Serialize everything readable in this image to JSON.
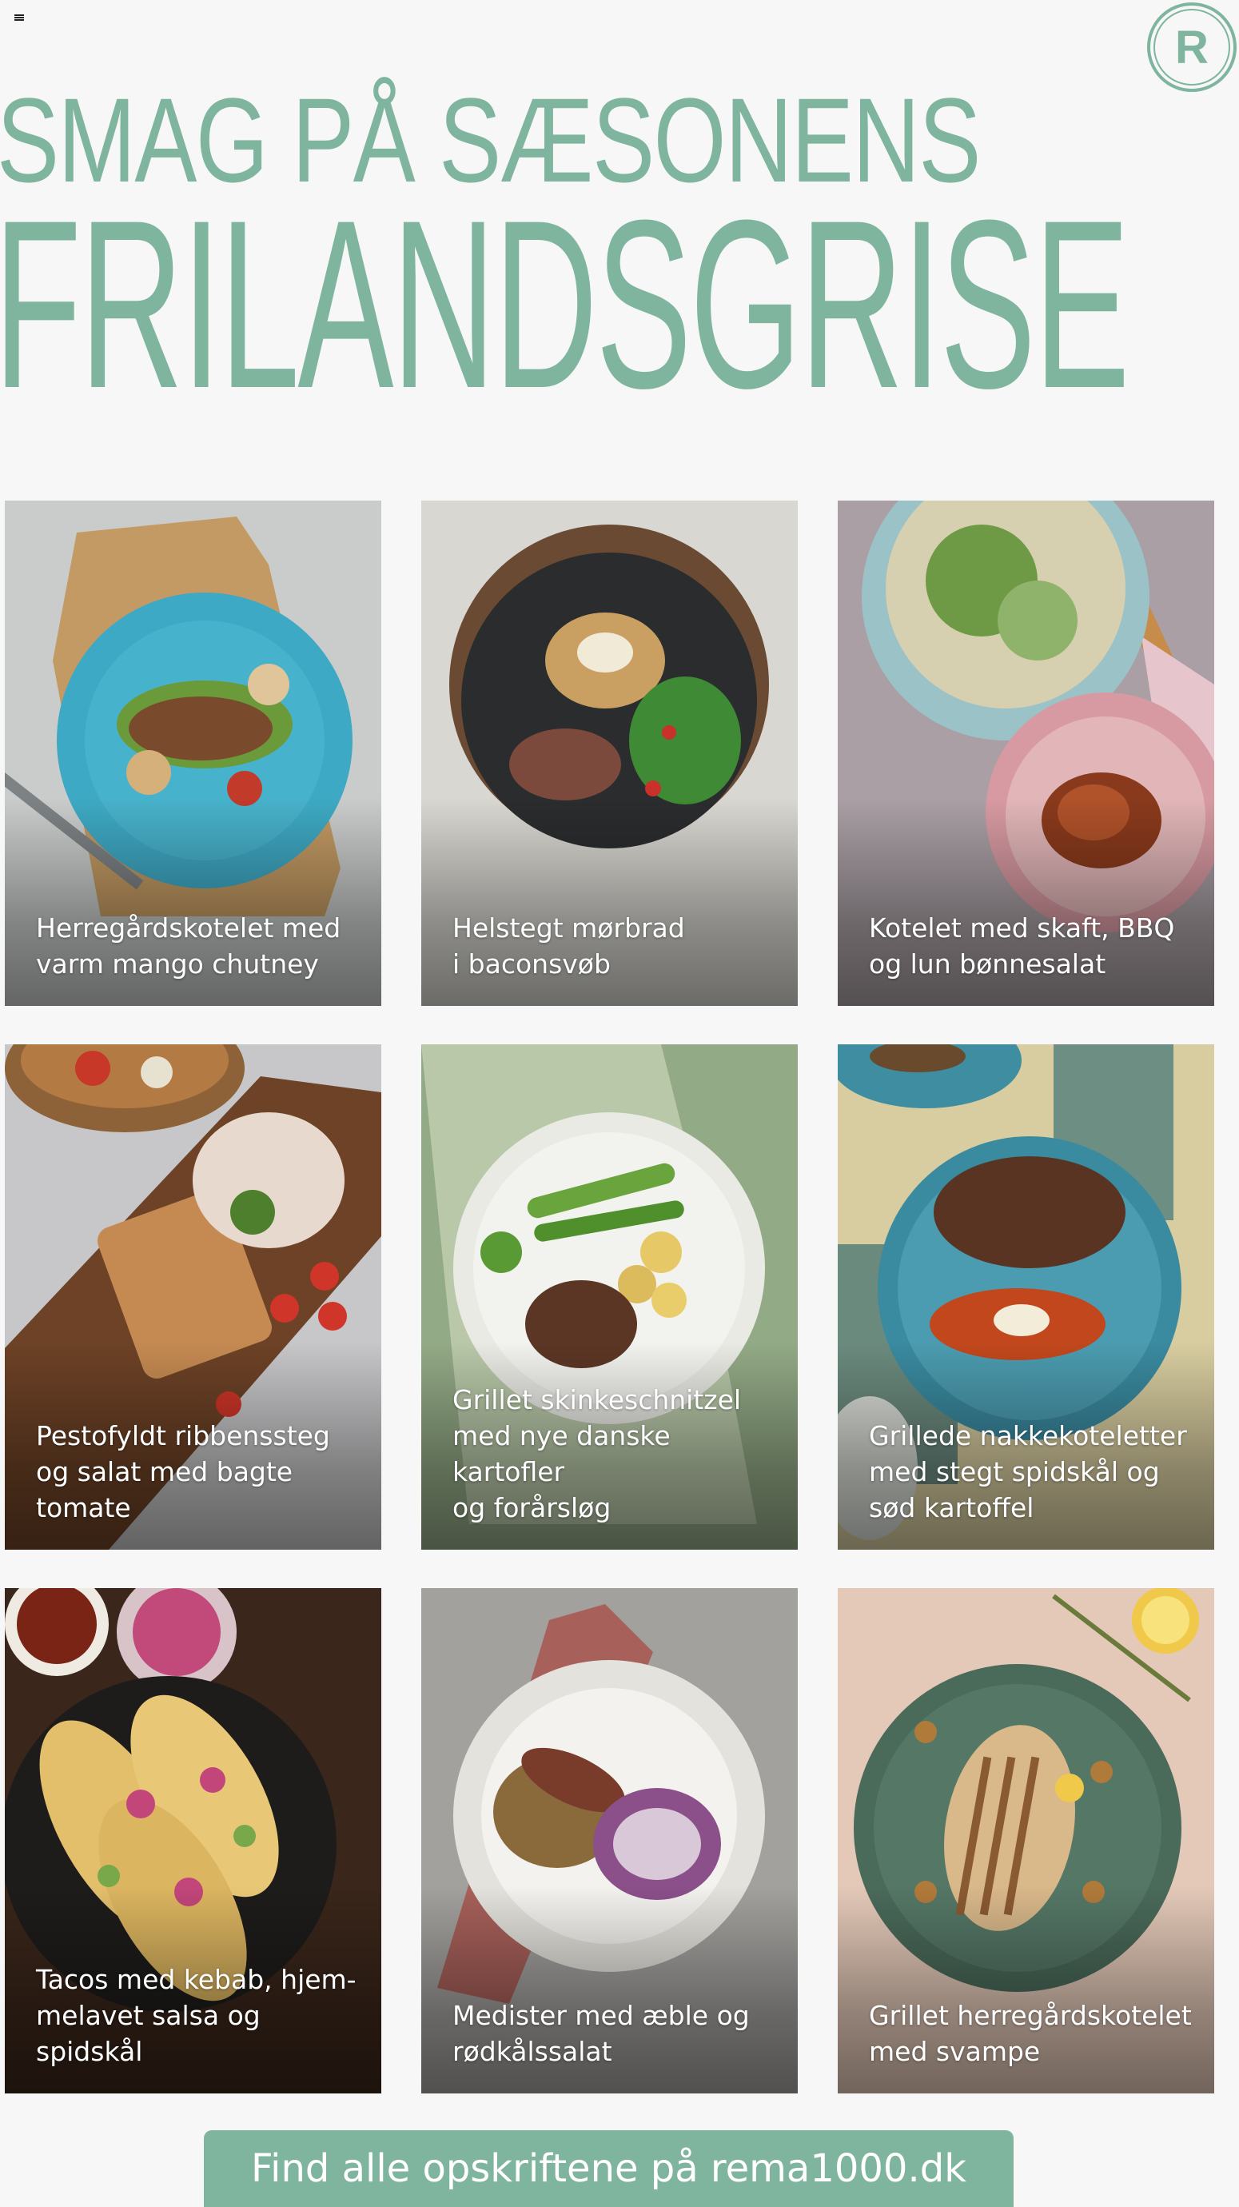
{
  "header": {
    "menu_icon": "menu-icon",
    "logo_letter": "R",
    "title_line1": "SMAG PÅ SÆSONENS",
    "title_line2": "FRILANDSGRISE"
  },
  "colors": {
    "brand_green": "#7fb59e",
    "background": "#f6f7f6",
    "caption_text": "#ffffff"
  },
  "recipes": [
    {
      "caption": "Herregårdskotelet med\nvarm mango chutney"
    },
    {
      "caption": "Helstegt mørbrad\ni baconsvøb"
    },
    {
      "caption": "Kotelet med skaft, BBQ\nog lun bønnesalat"
    },
    {
      "caption": "Pestofyldt ribbenssteg\nog salat med bagte\ntomate"
    },
    {
      "caption": "Grillet skinkeschnitzel\nmed nye danske kartofler\nog forårsløg"
    },
    {
      "caption": "Grillede nakkekoteletter\nmed stegt spidskål og\nsød kartoffel"
    },
    {
      "caption": "Tacos med kebab, hjem-\nmelavet salsa og spidskål"
    },
    {
      "caption": "Medister med æble og\nrødkålssalat"
    },
    {
      "caption": "Grillet herregårdskotelet\nmed svampe"
    }
  ],
  "cta": {
    "label": "Find alle opskriftene på rema1000.dk"
  }
}
